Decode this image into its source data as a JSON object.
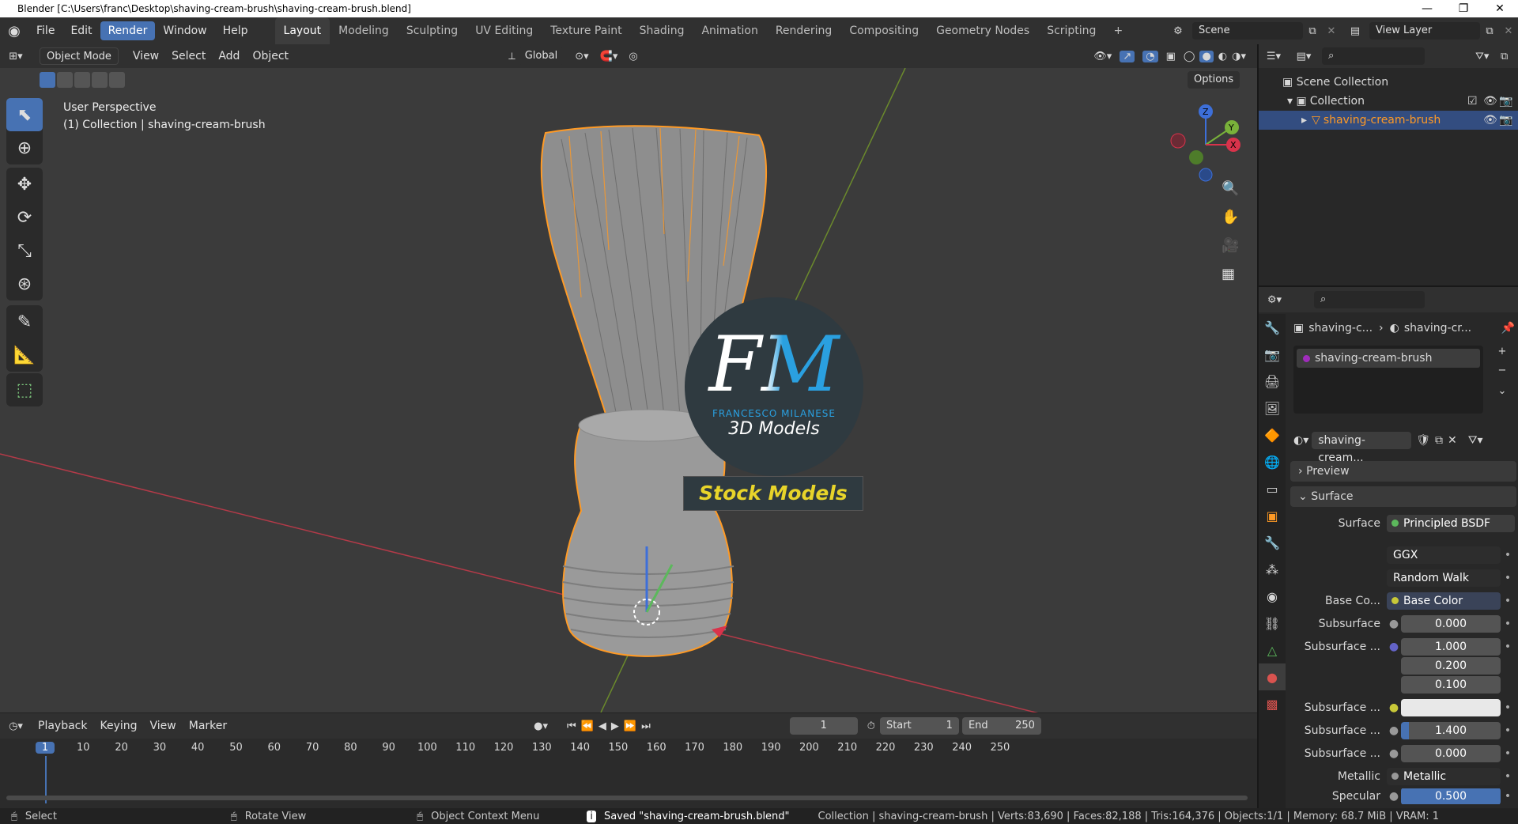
{
  "window": {
    "title": "Blender [C:\\Users\\franc\\Desktop\\shaving-cream-brush\\shaving-cream-brush.blend]",
    "min": "—",
    "max": "❐",
    "close": "✕"
  },
  "menus": [
    "File",
    "Edit",
    "Render",
    "Window",
    "Help"
  ],
  "workspaces": [
    "Layout",
    "Modeling",
    "Sculpting",
    "UV Editing",
    "Texture Paint",
    "Shading",
    "Animation",
    "Rendering",
    "Compositing",
    "Geometry Nodes",
    "Scripting"
  ],
  "add_workspace": "+",
  "scene": {
    "name": "Scene",
    "view_layer": "View Layer"
  },
  "viewport": {
    "mode": "Object Mode",
    "header_menus": [
      "View",
      "Select",
      "Add",
      "Object"
    ],
    "transform_orientation": "Global",
    "options": "Options",
    "overlay_title": "User Perspective",
    "overlay_sub": "(1) Collection | shaving-cream-brush",
    "logo": {
      "fm": "FM",
      "name": "FRANCESCO MILANESE",
      "models": "3D Models",
      "banner": "Stock Models"
    },
    "gizmo": {
      "x": "X",
      "y": "Y",
      "z": "Z"
    }
  },
  "timeline": {
    "menus": [
      "Playback",
      "Keying",
      "View",
      "Marker"
    ],
    "current_frame": "1",
    "start_label": "Start",
    "start": "1",
    "end_label": "End",
    "end": "250",
    "ruler": [
      "1",
      "10",
      "20",
      "30",
      "40",
      "50",
      "60",
      "70",
      "80",
      "90",
      "100",
      "110",
      "120",
      "130",
      "140",
      "150",
      "160",
      "170",
      "180",
      "190",
      "200",
      "210",
      "220",
      "230",
      "240",
      "250"
    ]
  },
  "status": {
    "select": "Select",
    "rotate": "Rotate View",
    "context": "Object Context Menu",
    "saved": "Saved \"shaving-cream-brush.blend\"",
    "stats": "Collection | shaving-cream-brush | Verts:83,690 | Faces:82,188 | Tris:164,376 | Objects:1/1 | Memory: 68.7 MiB | VRAM: 1"
  },
  "outliner": {
    "scene_collection": "Scene Collection",
    "collection": "Collection",
    "object": "shaving-cream-brush"
  },
  "properties": {
    "breadcrumb_obj": "shaving-c...",
    "breadcrumb_mat": "shaving-cr...",
    "slot": "shaving-cream-brush",
    "material": "shaving-cream...",
    "preview": "Preview",
    "surface_panel": "Surface",
    "surface_label": "Surface",
    "surface_value": "Principled BSDF",
    "distribution": "GGX",
    "subsurface_method": "Random Walk",
    "rows": [
      {
        "label": "Base Co...",
        "value": "Base Color"
      },
      {
        "label": "Subsurface",
        "value": "0.000"
      },
      {
        "label": "Subsurface ...",
        "value": "1.000"
      },
      {
        "label": "",
        "value": "0.200"
      },
      {
        "label": "",
        "value": "0.100"
      },
      {
        "label": "Subsurface ...",
        "value": ""
      },
      {
        "label": "Subsurface ...",
        "value": "1.400"
      },
      {
        "label": "Subsurface ...",
        "value": "0.000"
      },
      {
        "label": "Metallic",
        "value": "Metallic"
      },
      {
        "label": "Specular",
        "value": "0.500"
      }
    ]
  },
  "colors": {
    "accent": "#4772b3",
    "selected": "#ff9a25",
    "bg": "#303030"
  }
}
